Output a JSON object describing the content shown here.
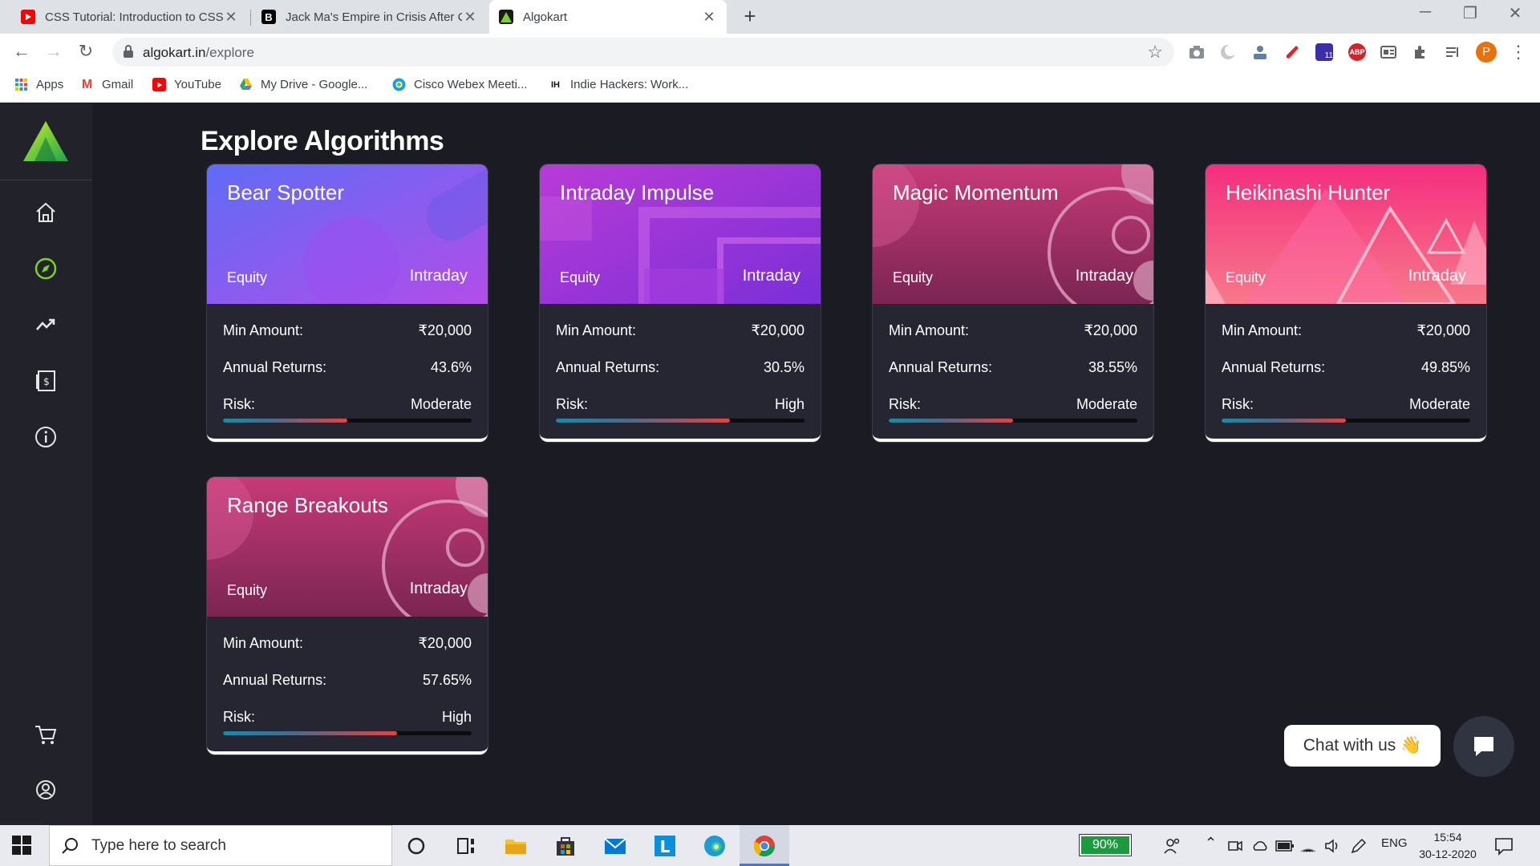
{
  "browser": {
    "tabs": [
      {
        "title": "CSS Tutorial: Introduction to CSS",
        "icon": "youtube-icon"
      },
      {
        "title": "Jack Ma's Empire in Crisis After C",
        "icon": "bloomberg-icon"
      },
      {
        "title": "Algokart",
        "icon": "algokart-icon",
        "active": true
      }
    ],
    "url_host": "algokart.in",
    "url_path": "/explore",
    "extension_badge": "11",
    "profile_initial": "P",
    "bookmarks": [
      {
        "label": "Apps",
        "icon": "apps-grid-icon"
      },
      {
        "label": "Gmail",
        "icon": "gmail-icon"
      },
      {
        "label": "YouTube",
        "icon": "youtube-icon"
      },
      {
        "label": "My Drive - Google...",
        "icon": "google-drive-icon"
      },
      {
        "label": "Cisco Webex Meeti...",
        "icon": "webex-icon"
      },
      {
        "label": "Indie Hackers: Work...",
        "icon": "indie-hackers-icon"
      }
    ]
  },
  "page": {
    "title": "Explore Algorithms"
  },
  "labels": {
    "min_amount": "Min Amount:",
    "annual_returns": "Annual Returns:",
    "risk": "Risk:"
  },
  "cards": [
    {
      "name": "Bear Spotter",
      "category": "Equity",
      "frequency": "Intraday",
      "min_amount": "₹20,000",
      "annual_returns": "43.6%",
      "risk": "Moderate",
      "risk_level": 0.5
    },
    {
      "name": "Intraday Impulse",
      "category": "Equity",
      "frequency": "Intraday",
      "min_amount": "₹20,000",
      "annual_returns": "30.5%",
      "risk": "High",
      "risk_level": 0.7
    },
    {
      "name": "Magic Momentum",
      "category": "Equity",
      "frequency": "Intraday",
      "min_amount": "₹20,000",
      "annual_returns": "38.55%",
      "risk": "Moderate",
      "risk_level": 0.5
    },
    {
      "name": "Heikinashi Hunter",
      "category": "Equity",
      "frequency": "Intraday",
      "min_amount": "₹20,000",
      "annual_returns": "49.85%",
      "risk": "Moderate",
      "risk_level": 0.5
    },
    {
      "name": "Range Breakouts",
      "category": "Equity",
      "frequency": "Intraday",
      "min_amount": "₹20,000",
      "annual_returns": "57.65%",
      "risk": "High",
      "risk_level": 0.7
    }
  ],
  "chat": {
    "label": "Chat with us 👋"
  },
  "taskbar": {
    "search_placeholder": "Type here to search",
    "battery": "90%",
    "language": "ENG",
    "time": "15:54",
    "date": "30-12-2020"
  },
  "colors": {
    "background": "#1b1b23",
    "sidebar": "#22222b",
    "card_body": "#262633",
    "accent_green": "#7ed321"
  }
}
